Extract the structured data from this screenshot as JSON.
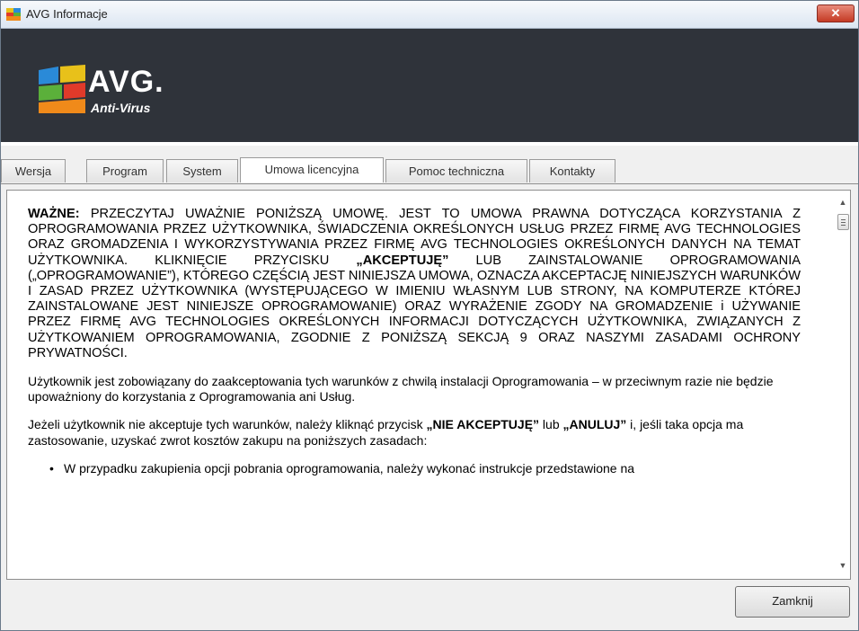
{
  "window": {
    "title": "AVG Informacje",
    "close_glyph": "✕"
  },
  "logo": {
    "name": "AVG.",
    "product": "Anti-Virus"
  },
  "tabs": [
    {
      "label": "Wersja"
    },
    {
      "label": "Program"
    },
    {
      "label": "System"
    },
    {
      "label": "Umowa licencyjna",
      "active": true
    },
    {
      "label": "Pomoc techniczna"
    },
    {
      "label": "Kontakty"
    }
  ],
  "license": {
    "p1_bold1": "WAŻNE:",
    "p1_a": " PRZECZYTAJ UWAŻNIE PONIŻSZĄ UMOWĘ. JEST TO UMOWA PRAWNA DOTYCZĄCA KORZYSTANIA Z OPROGRAMOWANIA PRZEZ UŻYTKOWNIKA, ŚWIADCZENIA OKREŚLONYCH USŁUG PRZEZ FIRMĘ AVG TECHNOLOGIES ORAZ GROMADZENIA I WYKORZYSTYWANIA PRZEZ FIRMĘ AVG TECHNOLOGIES OKREŚLONYCH DANYCH NA TEMAT UŻYTKOWNIKA. KLIKNIĘCIE PRZYCISKU ",
    "p1_bold2": "„AKCEPTUJĘ”",
    "p1_b": " LUB ZAINSTALOWANIE OPROGRAMOWANIA („OPROGRAMOWANIE”), KTÓREGO CZĘŚCIĄ JEST NINIEJSZA UMOWA, OZNACZA AKCEPTACJĘ NINIEJSZYCH WARUNKÓW I ZASAD PRZEZ UŻYTKOWNIKA (WYSTĘPUJĄCEGO W IMIENIU WŁASNYM LUB STRONY, NA KOMPUTERZE KTÓREJ ZAINSTALOWANE JEST NINIEJSZE OPROGRAMOWANIE) ORAZ WYRAŻENIE ZGODY NA GROMADZENIE i UŻYWANIE PRZEZ FIRMĘ AVG TECHNOLOGIES OKREŚLONYCH INFORMACJI DOTYCZĄCYCH UŻYTKOWNIKA, ZWIĄZANYCH Z UŻYTKOWANIEM OPROGRAMOWANIA, ZGODNIE Z PONIŻSZĄ SEKCJĄ 9 ORAZ NASZYMI ZASADAMI OCHRONY PRYWATNOŚCI.",
    "p2": "Użytkownik jest zobowiązany do zaakceptowania tych warunków z chwilą instalacji Oprogramowania – w przeciwnym razie nie będzie upoważniony do korzystania z Oprogramowania ani Usług.",
    "p3_a": "Jeżeli użytkownik nie akceptuje tych warunków, należy kliknąć przycisk ",
    "p3_bold1": "„NIE AKCEPTUJĘ”",
    "p3_b": " lub ",
    "p3_bold2": "„ANULUJ”",
    "p3_c": " i, jeśli taka opcja ma zastosowanie, uzyskać zwrot kosztów zakupu na poniższych zasadach:",
    "bullet1": "W przypadku zakupienia opcji pobrania oprogramowania, należy wykonać instrukcje przedstawione na"
  },
  "buttons": {
    "close_label": "Zamknij"
  },
  "colors": {
    "banner": "#2f333a",
    "close_red": "#c43a24"
  }
}
